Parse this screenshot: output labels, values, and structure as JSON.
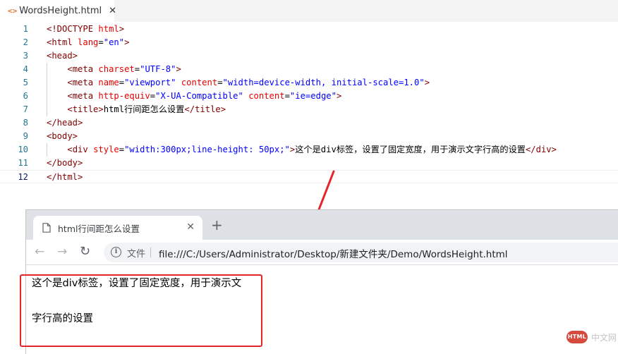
{
  "editor": {
    "tab": {
      "icon": "html-file-icon",
      "icon_glyph": "<>",
      "label": "WordsHeight.html",
      "close": "✕"
    },
    "lines": [
      {
        "n": "1",
        "tokens": [
          {
            "t": "tag",
            "v": "<!DOCTYPE"
          },
          {
            "t": "txt",
            "v": " "
          },
          {
            "t": "attr",
            "v": "html"
          },
          {
            "t": "tag",
            "v": ">"
          }
        ]
      },
      {
        "n": "2",
        "tokens": [
          {
            "t": "tag",
            "v": "<html"
          },
          {
            "t": "txt",
            "v": " "
          },
          {
            "t": "attr",
            "v": "lang"
          },
          {
            "t": "txt",
            "v": "="
          },
          {
            "t": "str",
            "v": "\"en\""
          },
          {
            "t": "tag",
            "v": ">"
          }
        ]
      },
      {
        "n": "3",
        "tokens": [
          {
            "t": "tag",
            "v": "<head>"
          }
        ]
      },
      {
        "n": "4",
        "tokens": [
          {
            "t": "txt",
            "v": "    "
          },
          {
            "t": "tag",
            "v": "<meta"
          },
          {
            "t": "txt",
            "v": " "
          },
          {
            "t": "attr",
            "v": "charset"
          },
          {
            "t": "txt",
            "v": "="
          },
          {
            "t": "str",
            "v": "\"UTF-8\""
          },
          {
            "t": "tag",
            "v": ">"
          }
        ]
      },
      {
        "n": "5",
        "tokens": [
          {
            "t": "txt",
            "v": "    "
          },
          {
            "t": "tag",
            "v": "<meta"
          },
          {
            "t": "txt",
            "v": " "
          },
          {
            "t": "attr",
            "v": "name"
          },
          {
            "t": "txt",
            "v": "="
          },
          {
            "t": "str",
            "v": "\"viewport\""
          },
          {
            "t": "txt",
            "v": " "
          },
          {
            "t": "attr",
            "v": "content"
          },
          {
            "t": "txt",
            "v": "="
          },
          {
            "t": "str",
            "v": "\"width=device-width, initial-scale=1.0\""
          },
          {
            "t": "tag",
            "v": ">"
          }
        ]
      },
      {
        "n": "6",
        "tokens": [
          {
            "t": "txt",
            "v": "    "
          },
          {
            "t": "tag",
            "v": "<meta"
          },
          {
            "t": "txt",
            "v": " "
          },
          {
            "t": "attr",
            "v": "http-equiv"
          },
          {
            "t": "txt",
            "v": "="
          },
          {
            "t": "str",
            "v": "\"X-UA-Compatible\""
          },
          {
            "t": "txt",
            "v": " "
          },
          {
            "t": "attr",
            "v": "content"
          },
          {
            "t": "txt",
            "v": "="
          },
          {
            "t": "str",
            "v": "\"ie=edge\""
          },
          {
            "t": "tag",
            "v": ">"
          }
        ]
      },
      {
        "n": "7",
        "tokens": [
          {
            "t": "txt",
            "v": "    "
          },
          {
            "t": "tag",
            "v": "<title>"
          },
          {
            "t": "txt",
            "v": "html行间距怎么设置"
          },
          {
            "t": "tag",
            "v": "</title>"
          }
        ]
      },
      {
        "n": "8",
        "tokens": [
          {
            "t": "tag",
            "v": "</head>"
          }
        ]
      },
      {
        "n": "9",
        "tokens": [
          {
            "t": "tag",
            "v": "<body>"
          }
        ]
      },
      {
        "n": "10",
        "tokens": [
          {
            "t": "txt",
            "v": "    "
          },
          {
            "t": "tag",
            "v": "<div"
          },
          {
            "t": "txt",
            "v": " "
          },
          {
            "t": "attr",
            "v": "style"
          },
          {
            "t": "txt",
            "v": "="
          },
          {
            "t": "str",
            "v": "\"width:300px;line-height: 50px;\""
          },
          {
            "t": "tag",
            "v": ">"
          },
          {
            "t": "txt",
            "v": "这个是div标签，设置了固定宽度，用于演示文字行高的设置"
          },
          {
            "t": "tag",
            "v": "</div>"
          }
        ]
      },
      {
        "n": "11",
        "tokens": [
          {
            "t": "tag",
            "v": "</body>"
          }
        ]
      },
      {
        "n": "12",
        "tokens": [
          {
            "t": "tag",
            "v": "</html>"
          }
        ]
      }
    ],
    "current_line": 12
  },
  "browser": {
    "tab": {
      "icon": "page-icon",
      "title": "html行间距怎么设置",
      "close": "✕"
    },
    "new_tab": "+",
    "nav": {
      "back": "←",
      "forward": "→",
      "reload": "↻"
    },
    "omnibox": {
      "info_icon": "i",
      "security_label": "文件",
      "url": "file:///C:/Users/Administrator/Desktop/新建文件夹/Demo/WordsHeight.html"
    },
    "content": {
      "text": "这个是div标签，设置了固定宽度，用于演示文字行高的设置"
    }
  },
  "annotation": {
    "arrow_color": "#e3262a",
    "box_color": "#e3262a"
  },
  "watermark": {
    "logo": "HTML",
    "text": "中文网"
  },
  "colors": {
    "tag": "#800000",
    "attr": "#e50000",
    "string": "#0000ff",
    "line_number": "#237893",
    "accent_red": "#e3262a"
  }
}
